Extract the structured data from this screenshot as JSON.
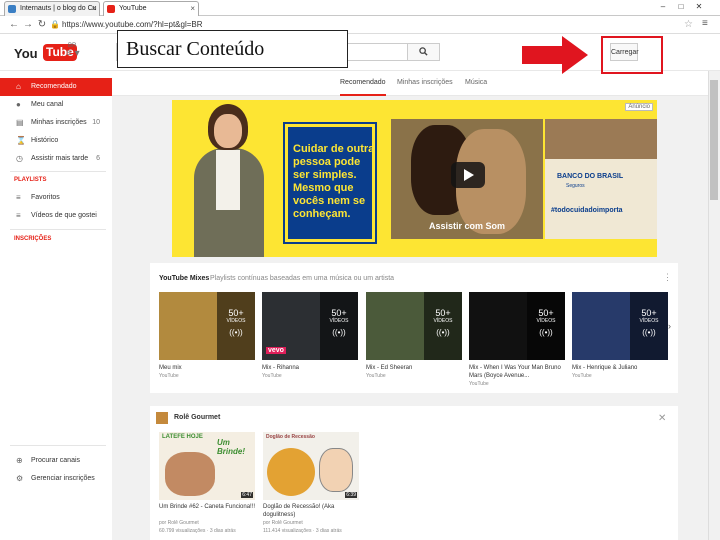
{
  "browser": {
    "tabs": [
      {
        "label": "Internauts | o blog do Cu"
      },
      {
        "label": "YouTube"
      }
    ],
    "url": "https://www.youtube.com/?hl=pt&gl=BR",
    "window_controls": {
      "min": "–",
      "max": "□",
      "close": "✕"
    }
  },
  "header": {
    "logo_you": "You",
    "logo_tube": "Tube",
    "logo_region": "BR",
    "upload_label": "Carregar"
  },
  "overlay": {
    "text": "Buscar Conteúdo"
  },
  "sidebar": {
    "items": [
      {
        "label": "Recomendado"
      },
      {
        "label": "Meu canal"
      },
      {
        "label": "Minhas inscrições",
        "count": "10"
      },
      {
        "label": "Histórico"
      },
      {
        "label": "Assistir mais tarde",
        "count": "6"
      }
    ],
    "playlists_header": "PLAYLISTS",
    "playlists": [
      {
        "label": "Favoritos"
      },
      {
        "label": "Vídeos de que gostei"
      }
    ],
    "subscriptions_header": "INSCRIÇÕES",
    "footer": [
      {
        "label": "Procurar canais"
      },
      {
        "label": "Gerenciar inscrições"
      }
    ]
  },
  "content_tabs": [
    {
      "label": "Recomendado"
    },
    {
      "label": "Minhas inscrições"
    },
    {
      "label": "Música"
    }
  ],
  "banner": {
    "ad_label": "Anúncio",
    "headline": "Cuidar de outra pessoa pode ser simples. Mesmo que vocês nem se conheçam.",
    "video_caption": "Assistir com Som",
    "bank_logo": "BANCO DO BRASIL",
    "bank_sub": "Seguros",
    "hashtag": "#todocuidadoimporta"
  },
  "mixes": {
    "title": "YouTube Mixes",
    "subtitle": "Playlists contínuas baseadas em uma música ou um artista",
    "count_label": "50+",
    "count_sub": "VÍDEOS",
    "vevo_label": "vevo",
    "items": [
      {
        "title": "Meu mix",
        "channel": "YouTube"
      },
      {
        "title": "Mix - Rihanna",
        "channel": "YouTube"
      },
      {
        "title": "Mix - Ed Sheeran",
        "channel": "YouTube"
      },
      {
        "title": "Mix - When I Was Your Man Bruno Mars (Boyce Avenue...",
        "channel": "YouTube"
      },
      {
        "title": "Mix - Henrique & Juliano",
        "channel": "YouTube"
      }
    ]
  },
  "gourmet": {
    "channel": "Rolê Gourmet",
    "items": [
      {
        "title": "Um Brinde #62 - Caneta Funciona!!!",
        "byline": "por Rolê Gourmet",
        "views": "60.799 visualizações · 3 dias atrás",
        "duration": "6:47",
        "thumb_header": "LATEFE HOJE",
        "thumb_text": "Um Brinde!"
      },
      {
        "title": "Doglão de Recessão! (Aka dogulitness)",
        "byline": "por Rolê Gourmet",
        "views": "111.414 visualizações · 3 dias atrás",
        "duration": "6:39",
        "thumb_header": "Doglão de Recessão",
        "thumb_text": ""
      }
    ]
  }
}
